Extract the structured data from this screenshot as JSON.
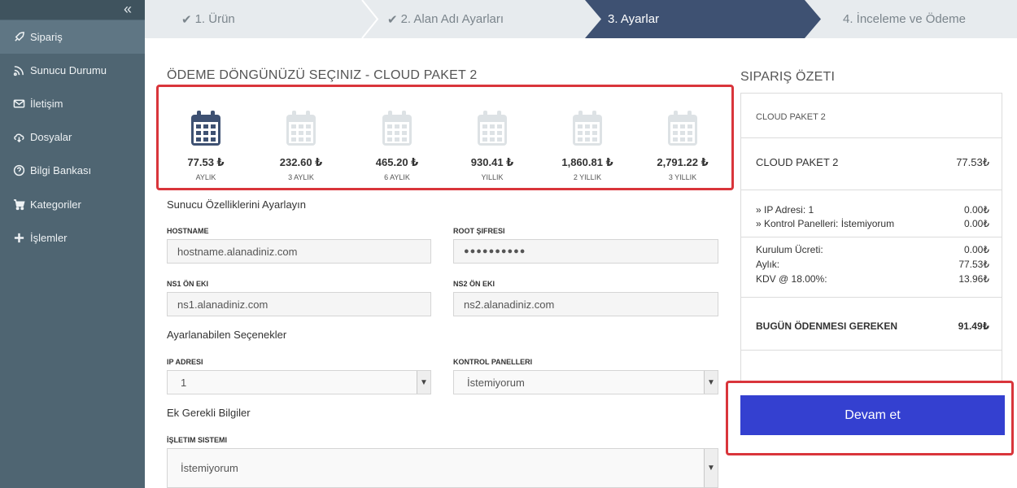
{
  "sidebar": {
    "collapse_icon": "double-chevron-left-icon",
    "items": [
      {
        "label": "Sipariş",
        "icon": "rocket-icon"
      },
      {
        "label": "Sunucu Durumu",
        "icon": "rss-icon"
      },
      {
        "label": "İletişim",
        "icon": "envelope-icon"
      },
      {
        "label": "Dosyalar",
        "icon": "cloud-download-icon"
      },
      {
        "label": "Bilgi Bankası",
        "icon": "question-circle-icon"
      },
      {
        "label": "Kategoriler",
        "icon": "cart-icon"
      },
      {
        "label": "İşlemler",
        "icon": "plus-icon"
      }
    ]
  },
  "steps": [
    {
      "label": "1. Ürün",
      "state": "done"
    },
    {
      "label": "2. Alan Adı Ayarları",
      "state": "done"
    },
    {
      "label": "3. Ayarlar",
      "state": "active"
    },
    {
      "label": "4. İnceleme ve Ödeme",
      "state": "pending"
    }
  ],
  "billing": {
    "title": "ÖDEME DÖNGÜNÜZÜ SEÇINIZ - CLOUD PAKET 2",
    "cycles": [
      {
        "price": "77.53 ₺",
        "period": "AYLIK",
        "selected": true
      },
      {
        "price": "232.60 ₺",
        "period": "3 AYLIK",
        "selected": false
      },
      {
        "price": "465.20 ₺",
        "period": "6 AYLIK",
        "selected": false
      },
      {
        "price": "930.41 ₺",
        "period": "YILLIK",
        "selected": false
      },
      {
        "price": "1,860.81 ₺",
        "period": "2 YILLIK",
        "selected": false
      },
      {
        "price": "2,791.22 ₺",
        "period": "3 YILLIK",
        "selected": false
      }
    ]
  },
  "server": {
    "heading": "Sunucu Özelliklerini Ayarlayın",
    "hostname_label": "HOSTNAME",
    "hostname_value": "hostname.alanadiniz.com",
    "root_label": "ROOT ŞIFRESI",
    "root_value": "●●●●●●●●●●",
    "ns1_label": "NS1 ÖN EKI",
    "ns1_value": "ns1.alanadiniz.com",
    "ns2_label": "NS2 ÖN EKI",
    "ns2_value": "ns2.alanadiniz.com"
  },
  "options": {
    "heading": "Ayarlanabilen Seçenekler",
    "ip_label": "IP ADRESI",
    "ip_value": "1",
    "panel_label": "KONTROL PANELLERI",
    "panel_value": "İstemiyorum"
  },
  "extra": {
    "heading": "Ek Gerekli Bilgiler",
    "os_label": "İŞLETIM SISTEMI",
    "os_value": "İstemiyorum"
  },
  "summary": {
    "title": "SIPARIŞ ÖZETI",
    "product_small": "CLOUD PAKET 2",
    "product_name": "CLOUD PAKET 2",
    "product_price": "77.53₺",
    "addon1_label": "» IP Adresi: 1",
    "addon1_value": "0.00₺",
    "addon2_label": "» Kontrol Panelleri: İstemiyorum",
    "addon2_value": "0.00₺",
    "setup_label": "Kurulum Ücreti:",
    "setup_value": "0.00₺",
    "monthly_label": "Aylık:",
    "monthly_value": "77.53₺",
    "tax_label": "KDV @ 18.00%:",
    "tax_value": "13.96₺",
    "total_label": "BUGÜN ÖDENMESI GEREKEN",
    "total_value": "91.49₺",
    "continue_label": "Devam et"
  },
  "colors": {
    "sidebar": "#4f6572",
    "active_step": "#3e5172",
    "highlight": "#d9353b",
    "primary_button": "#3440d0",
    "calendar_selected": "#3e5172",
    "calendar_unselected": "#dde2e5"
  }
}
